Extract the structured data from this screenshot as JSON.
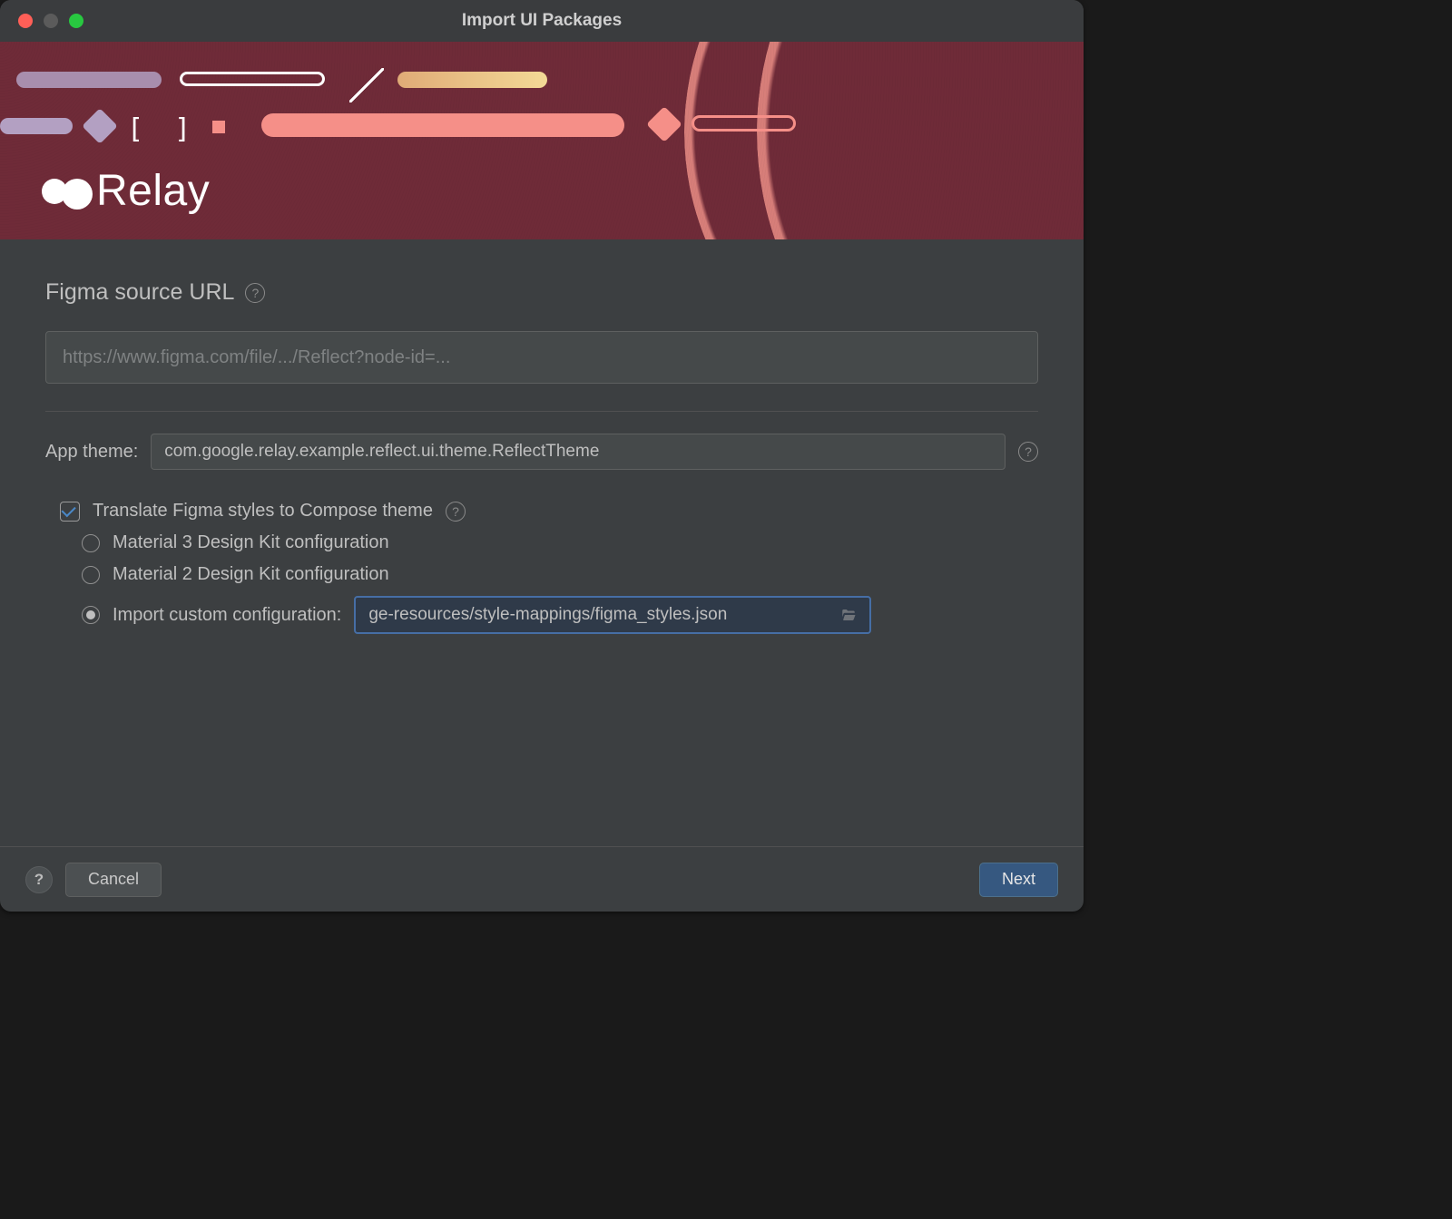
{
  "window": {
    "title": "Import UI Packages"
  },
  "banner": {
    "brand": "Relay",
    "brackets": "[ ]"
  },
  "form": {
    "figma_url_label": "Figma source URL",
    "figma_url_placeholder": "https://www.figma.com/file/.../Reflect?node-id=...",
    "app_theme_label": "App theme:",
    "app_theme_value": "com.google.relay.example.reflect.ui.theme.ReflectTheme",
    "translate_label": "Translate Figma styles to Compose theme",
    "translate_checked": true,
    "options": {
      "m3": {
        "label": "Material 3 Design Kit configuration",
        "selected": false
      },
      "m2": {
        "label": "Material 2 Design Kit configuration",
        "selected": false
      },
      "custom": {
        "label": "Import custom configuration:",
        "selected": true,
        "path": "ge-resources/style-mappings/figma_styles.json"
      }
    }
  },
  "footer": {
    "cancel": "Cancel",
    "next": "Next"
  },
  "glyphs": {
    "help": "?"
  }
}
